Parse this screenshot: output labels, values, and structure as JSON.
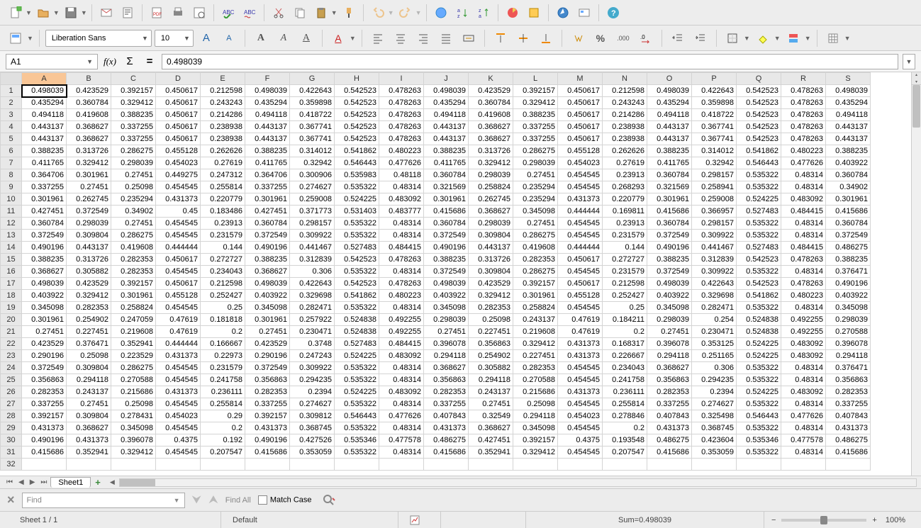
{
  "cell_ref": "A1",
  "formula_value": "0.498039",
  "font": {
    "name": "Liberation Sans",
    "size": "10"
  },
  "columns": [
    "A",
    "B",
    "C",
    "D",
    "E",
    "F",
    "G",
    "H",
    "I",
    "J",
    "K",
    "L",
    "M",
    "N",
    "O",
    "P",
    "Q",
    "R",
    "S"
  ],
  "active_col": "A",
  "active_row": 1,
  "rows": [
    [
      0.498039,
      0.423529,
      0.392157,
      0.450617,
      0.212598,
      0.498039,
      0.422643,
      0.542523,
      0.478263,
      0.498039,
      0.423529,
      0.392157,
      0.450617,
      0.212598,
      0.498039,
      0.422643,
      0.542523,
      0.478263,
      0.498039
    ],
    [
      0.435294,
      0.360784,
      0.329412,
      0.450617,
      0.243243,
      0.435294,
      0.359898,
      0.542523,
      0.478263,
      0.435294,
      0.360784,
      0.329412,
      0.450617,
      0.243243,
      0.435294,
      0.359898,
      0.542523,
      0.478263,
      0.435294
    ],
    [
      0.494118,
      0.419608,
      0.388235,
      0.450617,
      0.214286,
      0.494118,
      0.418722,
      0.542523,
      0.478263,
      0.494118,
      0.419608,
      0.388235,
      0.450617,
      0.214286,
      0.494118,
      0.418722,
      0.542523,
      0.478263,
      0.494118
    ],
    [
      0.443137,
      0.368627,
      0.337255,
      0.450617,
      0.238938,
      0.443137,
      0.367741,
      0.542523,
      0.478263,
      0.443137,
      0.368627,
      0.337255,
      0.450617,
      0.238938,
      0.443137,
      0.367741,
      0.542523,
      0.478263,
      0.443137
    ],
    [
      0.443137,
      0.368627,
      0.337255,
      0.450617,
      0.238938,
      0.443137,
      0.367741,
      0.542523,
      0.478263,
      0.443137,
      0.368627,
      0.337255,
      0.450617,
      0.238938,
      0.443137,
      0.367741,
      0.542523,
      0.478263,
      0.443137
    ],
    [
      0.388235,
      0.313726,
      0.286275,
      0.455128,
      0.262626,
      0.388235,
      0.314012,
      0.541862,
      0.480223,
      0.388235,
      0.313726,
      0.286275,
      0.455128,
      0.262626,
      0.388235,
      0.314012,
      0.541862,
      0.480223,
      0.388235
    ],
    [
      0.411765,
      0.329412,
      0.298039,
      0.454023,
      0.27619,
      0.411765,
      0.32942,
      0.546443,
      0.477626,
      0.411765,
      0.329412,
      0.298039,
      0.454023,
      0.27619,
      0.411765,
      0.32942,
      0.546443,
      0.477626,
      0.403922
    ],
    [
      0.364706,
      0.301961,
      0.27451,
      0.449275,
      0.247312,
      0.364706,
      0.300906,
      0.535983,
      0.48118,
      0.360784,
      0.298039,
      0.27451,
      0.454545,
      0.23913,
      0.360784,
      0.298157,
      0.535322,
      0.48314,
      0.360784
    ],
    [
      0.337255,
      0.27451,
      0.25098,
      0.454545,
      0.255814,
      0.337255,
      0.274627,
      0.535322,
      0.48314,
      0.321569,
      0.258824,
      0.235294,
      0.454545,
      0.268293,
      0.321569,
      0.258941,
      0.535322,
      0.48314,
      0.34902
    ],
    [
      0.301961,
      0.262745,
      0.235294,
      0.431373,
      0.220779,
      0.301961,
      0.259008,
      0.524225,
      0.483092,
      0.301961,
      0.262745,
      0.235294,
      0.431373,
      0.220779,
      0.301961,
      0.259008,
      0.524225,
      0.483092,
      0.301961
    ],
    [
      0.427451,
      0.372549,
      0.34902,
      0.45,
      0.183486,
      0.427451,
      0.371773,
      0.531403,
      0.483777,
      0.415686,
      0.368627,
      0.345098,
      0.444444,
      0.169811,
      0.415686,
      0.366957,
      0.527483,
      0.484415,
      0.415686
    ],
    [
      0.360784,
      0.298039,
      0.27451,
      0.454545,
      0.23913,
      0.360784,
      0.298157,
      0.535322,
      0.48314,
      0.360784,
      0.298039,
      0.27451,
      0.454545,
      0.23913,
      0.360784,
      0.298157,
      0.535322,
      0.48314,
      0.360784
    ],
    [
      0.372549,
      0.309804,
      0.286275,
      0.454545,
      0.231579,
      0.372549,
      0.309922,
      0.535322,
      0.48314,
      0.372549,
      0.309804,
      0.286275,
      0.454545,
      0.231579,
      0.372549,
      0.309922,
      0.535322,
      0.48314,
      0.372549
    ],
    [
      0.490196,
      0.443137,
      0.419608,
      0.444444,
      0.144,
      0.490196,
      0.441467,
      0.527483,
      0.484415,
      0.490196,
      0.443137,
      0.419608,
      0.444444,
      0.144,
      0.490196,
      0.441467,
      0.527483,
      0.484415,
      0.486275
    ],
    [
      0.388235,
      0.313726,
      0.282353,
      0.450617,
      0.272727,
      0.388235,
      0.312839,
      0.542523,
      0.478263,
      0.388235,
      0.313726,
      0.282353,
      0.450617,
      0.272727,
      0.388235,
      0.312839,
      0.542523,
      0.478263,
      0.388235
    ],
    [
      0.368627,
      0.305882,
      0.282353,
      0.454545,
      0.234043,
      0.368627,
      0.306,
      0.535322,
      0.48314,
      0.372549,
      0.309804,
      0.286275,
      0.454545,
      0.231579,
      0.372549,
      0.309922,
      0.535322,
      0.48314,
      0.376471
    ],
    [
      0.498039,
      0.423529,
      0.392157,
      0.450617,
      0.212598,
      0.498039,
      0.422643,
      0.542523,
      0.478263,
      0.498039,
      0.423529,
      0.392157,
      0.450617,
      0.212598,
      0.498039,
      0.422643,
      0.542523,
      0.478263,
      0.490196
    ],
    [
      0.403922,
      0.329412,
      0.301961,
      0.455128,
      0.252427,
      0.403922,
      0.329698,
      0.541862,
      0.480223,
      0.403922,
      0.329412,
      0.301961,
      0.455128,
      0.252427,
      0.403922,
      0.329698,
      0.541862,
      0.480223,
      0.403922
    ],
    [
      0.345098,
      0.282353,
      0.258824,
      0.454545,
      0.25,
      0.345098,
      0.282471,
      0.535322,
      0.48314,
      0.345098,
      0.282353,
      0.258824,
      0.454545,
      0.25,
      0.345098,
      0.282471,
      0.535322,
      0.48314,
      0.345098
    ],
    [
      0.301961,
      0.254902,
      0.247059,
      0.47619,
      0.181818,
      0.301961,
      0.257922,
      0.524838,
      0.492255,
      0.298039,
      0.25098,
      0.243137,
      0.47619,
      0.184211,
      0.298039,
      0.254,
      0.524838,
      0.492255,
      0.298039
    ],
    [
      0.27451,
      0.227451,
      0.219608,
      0.47619,
      0.2,
      0.27451,
      0.230471,
      0.524838,
      0.492255,
      0.27451,
      0.227451,
      0.219608,
      0.47619,
      0.2,
      0.27451,
      0.230471,
      0.524838,
      0.492255,
      0.270588
    ],
    [
      0.423529,
      0.376471,
      0.352941,
      0.444444,
      0.166667,
      0.423529,
      0.3748,
      0.527483,
      0.484415,
      0.396078,
      0.356863,
      0.329412,
      0.431373,
      0.168317,
      0.396078,
      0.353125,
      0.524225,
      0.483092,
      0.396078
    ],
    [
      0.290196,
      0.25098,
      0.223529,
      0.431373,
      0.22973,
      0.290196,
      0.247243,
      0.524225,
      0.483092,
      0.294118,
      0.254902,
      0.227451,
      0.431373,
      0.226667,
      0.294118,
      0.251165,
      0.524225,
      0.483092,
      0.294118
    ],
    [
      0.372549,
      0.309804,
      0.286275,
      0.454545,
      0.231579,
      0.372549,
      0.309922,
      0.535322,
      0.48314,
      0.368627,
      0.305882,
      0.282353,
      0.454545,
      0.234043,
      0.368627,
      0.306,
      0.535322,
      0.48314,
      0.376471
    ],
    [
      0.356863,
      0.294118,
      0.270588,
      0.454545,
      0.241758,
      0.356863,
      0.294235,
      0.535322,
      0.48314,
      0.356863,
      0.294118,
      0.270588,
      0.454545,
      0.241758,
      0.356863,
      0.294235,
      0.535322,
      0.48314,
      0.356863
    ],
    [
      0.282353,
      0.243137,
      0.215686,
      0.431373,
      0.236111,
      0.282353,
      0.2394,
      0.524225,
      0.483092,
      0.282353,
      0.243137,
      0.215686,
      0.431373,
      0.236111,
      0.282353,
      0.2394,
      0.524225,
      0.483092,
      0.282353
    ],
    [
      0.337255,
      0.27451,
      0.25098,
      0.454545,
      0.255814,
      0.337255,
      0.274627,
      0.535322,
      0.48314,
      0.337255,
      0.27451,
      0.25098,
      0.454545,
      0.255814,
      0.337255,
      0.274627,
      0.535322,
      0.48314,
      0.337255
    ],
    [
      0.392157,
      0.309804,
      0.278431,
      0.454023,
      0.29,
      0.392157,
      0.309812,
      0.546443,
      0.477626,
      0.407843,
      0.32549,
      0.294118,
      0.454023,
      0.278846,
      0.407843,
      0.325498,
      0.546443,
      0.477626,
      0.407843
    ],
    [
      0.431373,
      0.368627,
      0.345098,
      0.454545,
      0.2,
      0.431373,
      0.368745,
      0.535322,
      0.48314,
      0.431373,
      0.368627,
      0.345098,
      0.454545,
      0.2,
      0.431373,
      0.368745,
      0.535322,
      0.48314,
      0.431373
    ],
    [
      0.490196,
      0.431373,
      0.396078,
      0.4375,
      0.192,
      0.490196,
      0.427526,
      0.535346,
      0.477578,
      0.486275,
      0.427451,
      0.392157,
      0.4375,
      0.193548,
      0.486275,
      0.423604,
      0.535346,
      0.477578,
      0.486275
    ],
    [
      0.415686,
      0.352941,
      0.329412,
      0.454545,
      0.207547,
      0.415686,
      0.353059,
      0.535322,
      0.48314,
      0.415686,
      0.352941,
      0.329412,
      0.454545,
      0.207547,
      0.415686,
      0.353059,
      0.535322,
      0.48314,
      0.415686
    ]
  ],
  "sheet_tab": "Sheet1",
  "find": {
    "placeholder": "Find",
    "find_all": "Find All",
    "match_case": "Match Case"
  },
  "status": {
    "sheet": "Sheet 1 / 1",
    "style": "Default",
    "sum": "Sum=0.498039",
    "zoom": "100%"
  }
}
